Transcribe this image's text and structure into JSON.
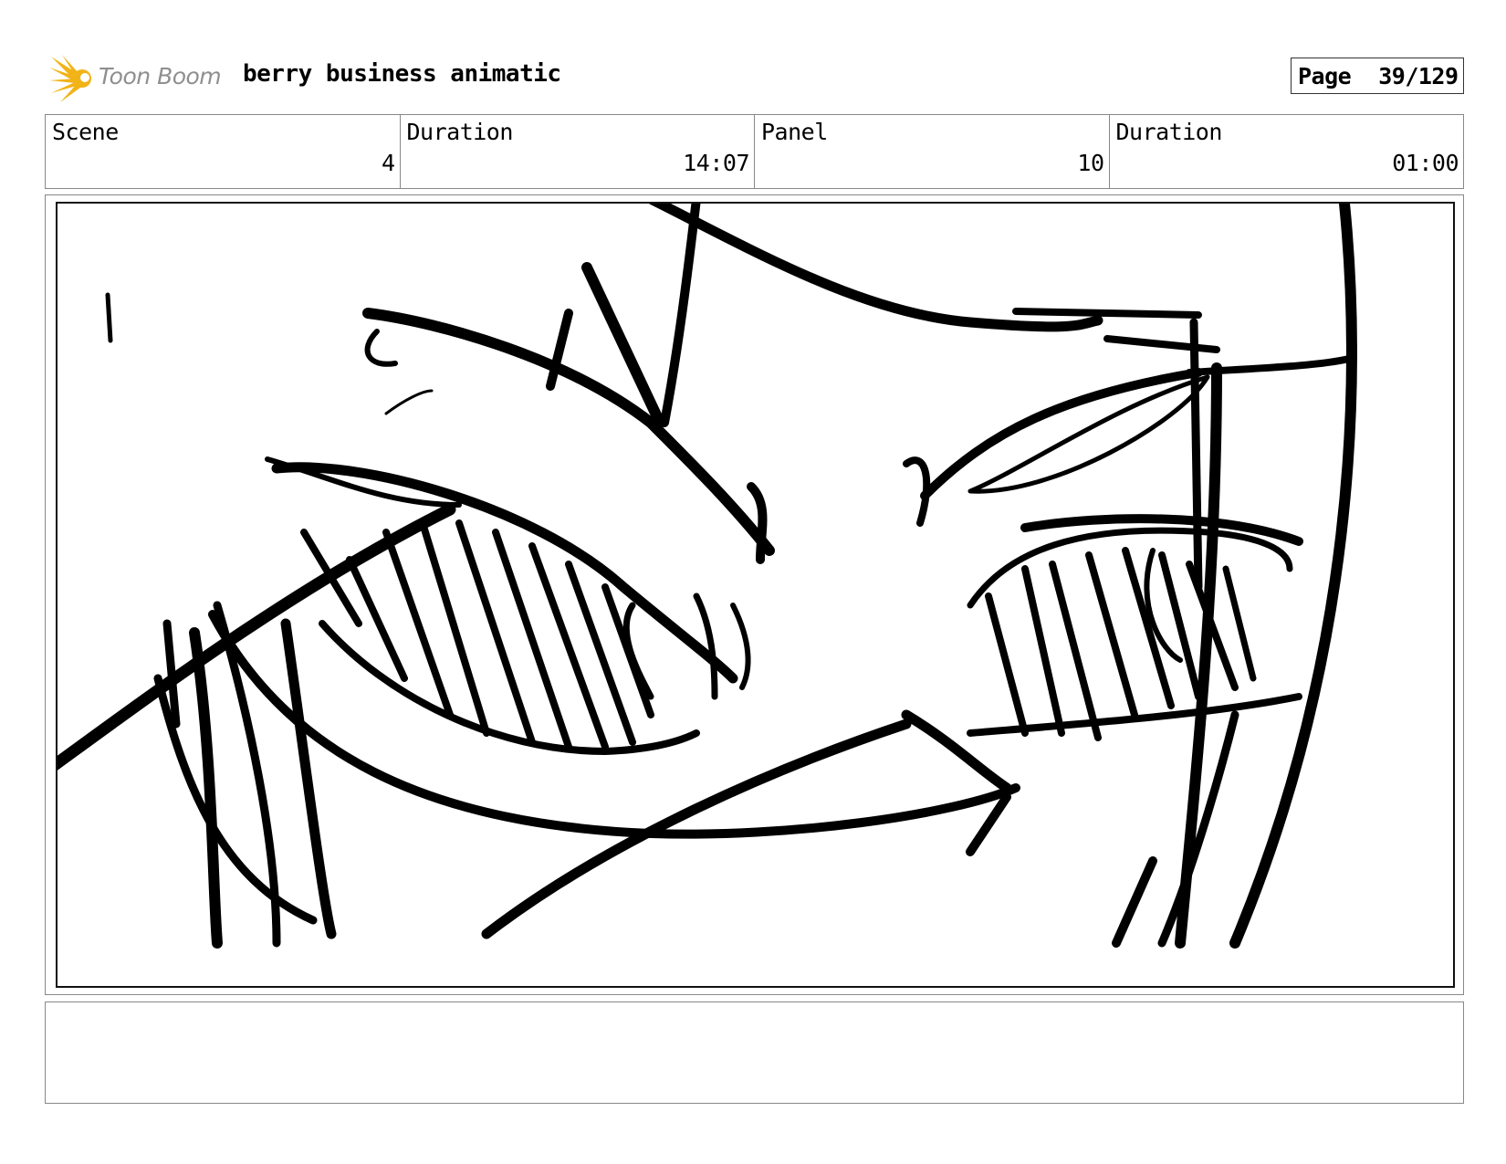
{
  "header": {
    "logo_text": "Toon Boom",
    "logo_icon": "starburst-icon",
    "title": "berry business animatic",
    "page_label": "Page",
    "page_value": "39/129"
  },
  "info": {
    "scene_label": "Scene",
    "scene_value": "4",
    "scene_duration_label": "Duration",
    "scene_duration_value": "14:07",
    "panel_label": "Panel",
    "panel_value": "10",
    "panel_duration_label": "Duration",
    "panel_duration_value": "01:00"
  },
  "panel": {
    "image": "rough black-ink storyboard sketch close-up of angry eyes"
  },
  "notes": {
    "text": ""
  },
  "colors": {
    "logo_star": "#f2b318",
    "logo_text": "#8f8f8f",
    "border": "#888888"
  }
}
